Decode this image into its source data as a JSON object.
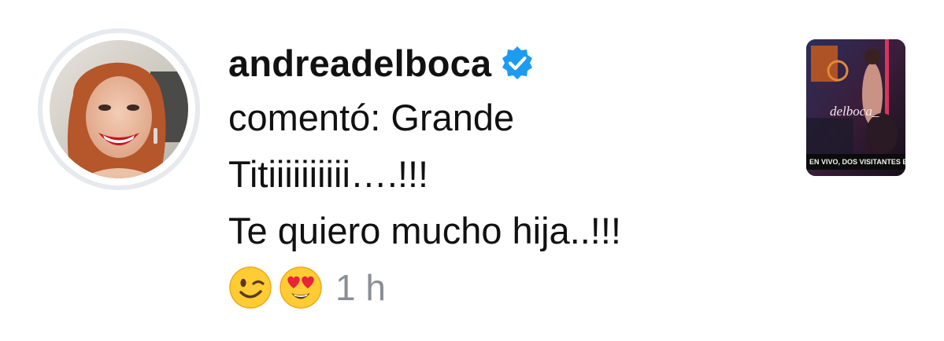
{
  "notification": {
    "username": "andreadelboca",
    "verified": true,
    "comment_lines": [
      "comentó: Grande",
      "Titiiiiiiiiii….!!!",
      "Te quiero mucho hija..!!!"
    ],
    "emojis": [
      "winking-face",
      "smiling-face-with-heart-eyes"
    ],
    "timestamp": "1 h",
    "thumbnail": {
      "handle": "delboca_",
      "caption": "EN VIVO, DOS VISITANTES EN"
    }
  },
  "colors": {
    "text": "#111111",
    "muted": "#8a8f96",
    "verified_blue": "#1d9bf0",
    "avatar_ring": "#e6e9ee"
  }
}
